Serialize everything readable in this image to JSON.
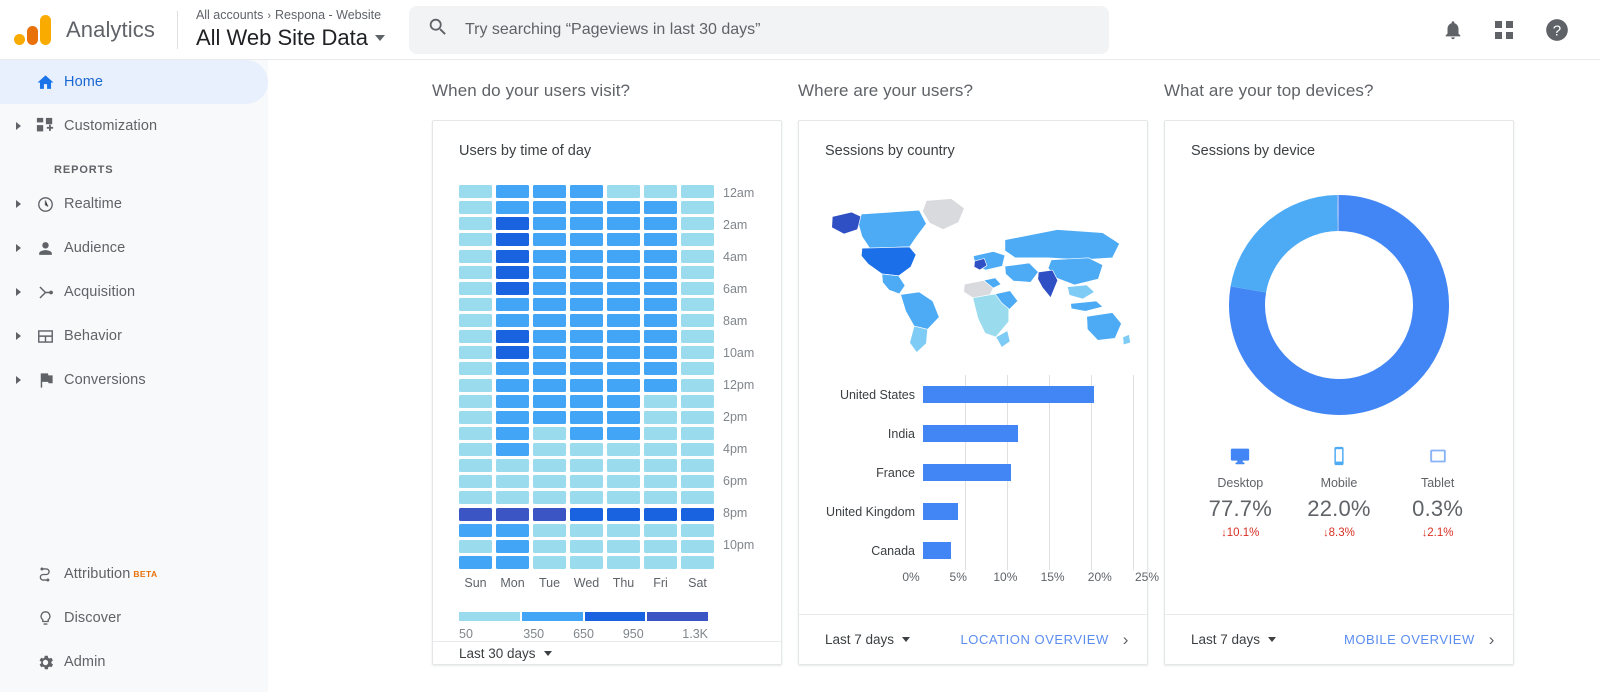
{
  "header": {
    "brand": "Analytics",
    "logo_icon": "analytics-logo-icon",
    "breadcrumb_accounts": "All accounts",
    "breadcrumb_sep": "›",
    "breadcrumb_property": "Respona - Website",
    "view_name": "All Web Site Data",
    "search_placeholder": "Try searching “Pageviews in last 30 days”",
    "search_value": "",
    "search_icon": "search-icon",
    "notifications_icon": "bell-icon",
    "apps_icon": "apps-grid-icon",
    "help_icon": "help-circle-icon"
  },
  "sidebar": {
    "section_label": "REPORTS",
    "items": [
      {
        "label": "Home",
        "icon": "home-icon",
        "active": true,
        "expandable": false
      },
      {
        "label": "Customization",
        "icon": "customization-icon",
        "active": false,
        "expandable": true
      }
    ],
    "reports": [
      {
        "label": "Realtime",
        "icon": "clock-icon"
      },
      {
        "label": "Audience",
        "icon": "person-icon"
      },
      {
        "label": "Acquisition",
        "icon": "acquisition-icon"
      },
      {
        "label": "Behavior",
        "icon": "behavior-icon"
      },
      {
        "label": "Conversions",
        "icon": "flag-icon"
      }
    ],
    "bottom": [
      {
        "label": "Attribution",
        "icon": "attribution-icon",
        "badge": "BETA"
      },
      {
        "label": "Discover",
        "icon": "lightbulb-icon",
        "badge": ""
      },
      {
        "label": "Admin",
        "icon": "gear-icon",
        "badge": ""
      }
    ]
  },
  "columns": [
    {
      "heading": "When do your users visit?"
    },
    {
      "heading": "Where are your users?"
    },
    {
      "heading": "What are your top devices?"
    }
  ],
  "cards": {
    "time_of_day": {
      "title": "Users by time of day",
      "date_range": "Last 30 days",
      "footer_link": "",
      "days": [
        "Sun",
        "Mon",
        "Tue",
        "Wed",
        "Thu",
        "Fri",
        "Sat"
      ],
      "hour_labels": [
        "12am",
        "",
        "2am",
        "",
        "4am",
        "",
        "6am",
        "",
        "8am",
        "",
        "10am",
        "",
        "12pm",
        "",
        "2pm",
        "",
        "4pm",
        "",
        "6pm",
        "",
        "8pm",
        "",
        "10pm",
        ""
      ],
      "legend_ticks": [
        "50",
        "350",
        "650",
        "950",
        "1.3K"
      ],
      "legend_colors": [
        "#9adcee",
        "#42a5f5",
        "#1a63e0",
        "#3b55c4"
      ]
    },
    "country": {
      "title": "Sessions by country",
      "date_range": "Last 7 days",
      "footer_link": "LOCATION OVERVIEW",
      "chevron_icon": "chevron-right-icon",
      "map_icon": "world-map-icon"
    },
    "device": {
      "title": "Sessions by device",
      "date_range": "Last 7 days",
      "footer_link": "MOBILE OVERVIEW",
      "chevron_icon": "chevron-right-icon",
      "devices": [
        {
          "name": "Desktop",
          "icon": "desktop-icon",
          "percent": "77.7%",
          "delta": "10.1%",
          "delta_dir": "down",
          "color": "#4285f4"
        },
        {
          "name": "Mobile",
          "icon": "mobile-icon",
          "percent": "22.0%",
          "delta": "8.3%",
          "delta_dir": "down",
          "color": "#4dabf5"
        },
        {
          "name": "Tablet",
          "icon": "tablet-icon",
          "percent": "0.3%",
          "delta": "2.1%",
          "delta_dir": "down",
          "color": "#8ab4f8"
        }
      ]
    }
  },
  "chart_data": [
    {
      "type": "heatmap",
      "title": "Users by time of day",
      "xlabel": "",
      "ylabel": "",
      "categories": [
        "Sun",
        "Mon",
        "Tue",
        "Wed",
        "Thu",
        "Fri",
        "Sat"
      ],
      "rows": [
        "12am",
        "1am",
        "2am",
        "3am",
        "4am",
        "5am",
        "6am",
        "7am",
        "8am",
        "9am",
        "10am",
        "11am",
        "12pm",
        "1pm",
        "2pm",
        "3pm",
        "4pm",
        "5pm",
        "6pm",
        "7pm",
        "8pm",
        "9pm",
        "10pm",
        "11pm"
      ],
      "legend_scale": [
        50,
        350,
        650,
        950,
        1300
      ],
      "legend_colors": [
        "#9adcee",
        "#42a5f5",
        "#1a63e0",
        "#3b55c4"
      ],
      "values": [
        [
          1,
          2,
          2,
          2,
          1,
          1,
          1
        ],
        [
          1,
          2,
          2,
          2,
          2,
          2,
          1
        ],
        [
          1,
          3,
          2,
          2,
          2,
          2,
          1
        ],
        [
          1,
          3,
          2,
          2,
          2,
          2,
          1
        ],
        [
          1,
          3,
          2,
          2,
          2,
          2,
          1
        ],
        [
          1,
          3,
          2,
          2,
          2,
          2,
          1
        ],
        [
          1,
          3,
          2,
          2,
          2,
          2,
          1
        ],
        [
          1,
          2,
          2,
          2,
          2,
          2,
          1
        ],
        [
          1,
          2,
          2,
          2,
          2,
          2,
          1
        ],
        [
          1,
          3,
          2,
          2,
          2,
          2,
          1
        ],
        [
          1,
          3,
          2,
          2,
          2,
          2,
          1
        ],
        [
          1,
          2,
          2,
          2,
          2,
          2,
          1
        ],
        [
          1,
          2,
          2,
          2,
          2,
          2,
          1
        ],
        [
          1,
          2,
          2,
          2,
          2,
          1,
          1
        ],
        [
          1,
          2,
          2,
          2,
          2,
          1,
          1
        ],
        [
          1,
          2,
          1,
          2,
          2,
          1,
          1
        ],
        [
          1,
          2,
          1,
          1,
          1,
          1,
          1
        ],
        [
          1,
          1,
          1,
          1,
          1,
          1,
          1
        ],
        [
          1,
          1,
          1,
          1,
          1,
          1,
          1
        ],
        [
          1,
          1,
          1,
          1,
          1,
          1,
          1
        ],
        [
          4,
          4,
          4,
          3,
          3,
          3,
          3
        ],
        [
          2,
          2,
          1,
          1,
          1,
          1,
          1
        ],
        [
          1,
          2,
          1,
          1,
          1,
          1,
          1
        ],
        [
          2,
          2,
          1,
          1,
          1,
          1,
          1
        ]
      ]
    },
    {
      "type": "bar",
      "title": "Sessions by country",
      "orientation": "horizontal",
      "categories": [
        "United States",
        "India",
        "France",
        "United Kingdom",
        "Canada"
      ],
      "values": [
        20.3,
        11.3,
        10.5,
        4.2,
        3.3
      ],
      "xlabel": "",
      "ylabel": "",
      "xlim": [
        0,
        25
      ],
      "tick_labels": [
        "0%",
        "5%",
        "10%",
        "15%",
        "20%",
        "25%"
      ],
      "grid": true,
      "bar_color": "#4285f4"
    },
    {
      "type": "pie",
      "subtype": "donut",
      "title": "Sessions by device",
      "labels": [
        "Desktop",
        "Mobile",
        "Tablet"
      ],
      "values": [
        77.7,
        22.0,
        0.3
      ],
      "colors": [
        "#4285f4",
        "#4dabf5",
        "#8ab4f8"
      ],
      "legend": "bottom"
    }
  ]
}
